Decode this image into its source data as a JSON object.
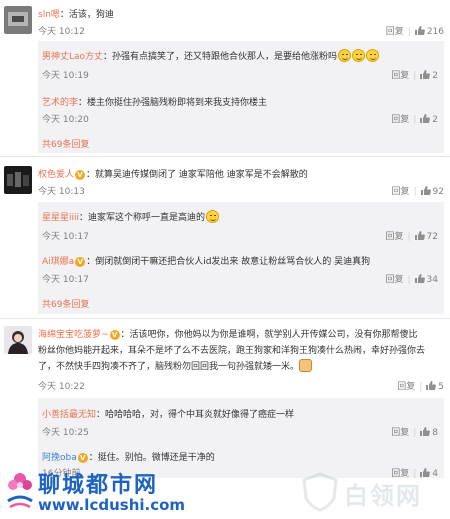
{
  "comments": [
    {
      "user": "sln嗯",
      "text": "：活该，狗迪",
      "time": "10:12",
      "reply": "回复",
      "likes": "216"
    },
    {
      "user": "权色爱人",
      "text": "：就算吴迪传媒倒闭了 迪家军陪他 迪家军是不会解散的",
      "time": "10:13",
      "reply": "回复",
      "likes": "92"
    },
    {
      "user": "海绵宝宝吃菠萝~",
      "text_line1": "：活该吧你，你他妈以为你是谁啊，就学别人开传媒公司，没有你那帮傻比",
      "text_line2": "粉丝你他妈能开起来，耳朵不是坏了么不去医院，跑王狗家和洋狗王狗凑什么热闹，幸好孙强你去",
      "text_line3": "了，不然快手四狗凑不齐了，脑残粉勿回回我一句孙强就矮一米。",
      "time": "10:22",
      "reply": "回复",
      "likes": "5"
    }
  ],
  "replies_a": [
    {
      "user": "男神丈Lao方丈",
      "text": "：孙强有点搞笑了，还又特跟他合伙那人，是要给他涨粉吗",
      "time": "10:19",
      "reply": "回复",
      "likes": "2"
    },
    {
      "user": "艺术的李",
      "text": "：楼主你挺住孙强脑残粉即将到来我支持你楼主",
      "time": "10:20",
      "reply": "回复",
      "likes": "2"
    }
  ],
  "replies_a_more": "共69条回复",
  "replies_b": [
    {
      "user": "星星星iiii",
      "text": "：迪家军这个称呼一直是高迪的",
      "time": "10:17",
      "reply": "回复",
      "likes": "72"
    },
    {
      "user": "Ai琪娜a",
      "text": "：倒闭就倒闭干嘛还把合伙人id发出来 故意让粉丝骂合伙人的  吴迪真狗",
      "time": "10:17",
      "reply": "回复",
      "likes": "34"
    }
  ],
  "replies_b_more": "共69条回复",
  "replies_c": [
    {
      "user": "小善括最无知",
      "text": "：哈哈哈哈，对，得个中耳炎就好像得了癌症一样",
      "time": "10:25",
      "reply": "回复",
      "likes": "8"
    },
    {
      "user": "阿挽oba",
      "text": "：挺住。别怕。微博还是干净的",
      "time": "16分钟前",
      "reply": "回复",
      "likes": "4"
    }
  ],
  "date_prefix": "今天",
  "watermark": {
    "site_name": "聊城都市网",
    "site_url": "www.lcdushi.com",
    "right_mark": "白领网"
  },
  "colors": {
    "username": "#eb7350",
    "link": "#3b7fd4",
    "watermark": "#1e63c4",
    "reply_bg": "#f2f2f5"
  },
  "icons": [
    "thumb-up-icon",
    "vip-badge-icon",
    "smile-emoji-icon"
  ]
}
